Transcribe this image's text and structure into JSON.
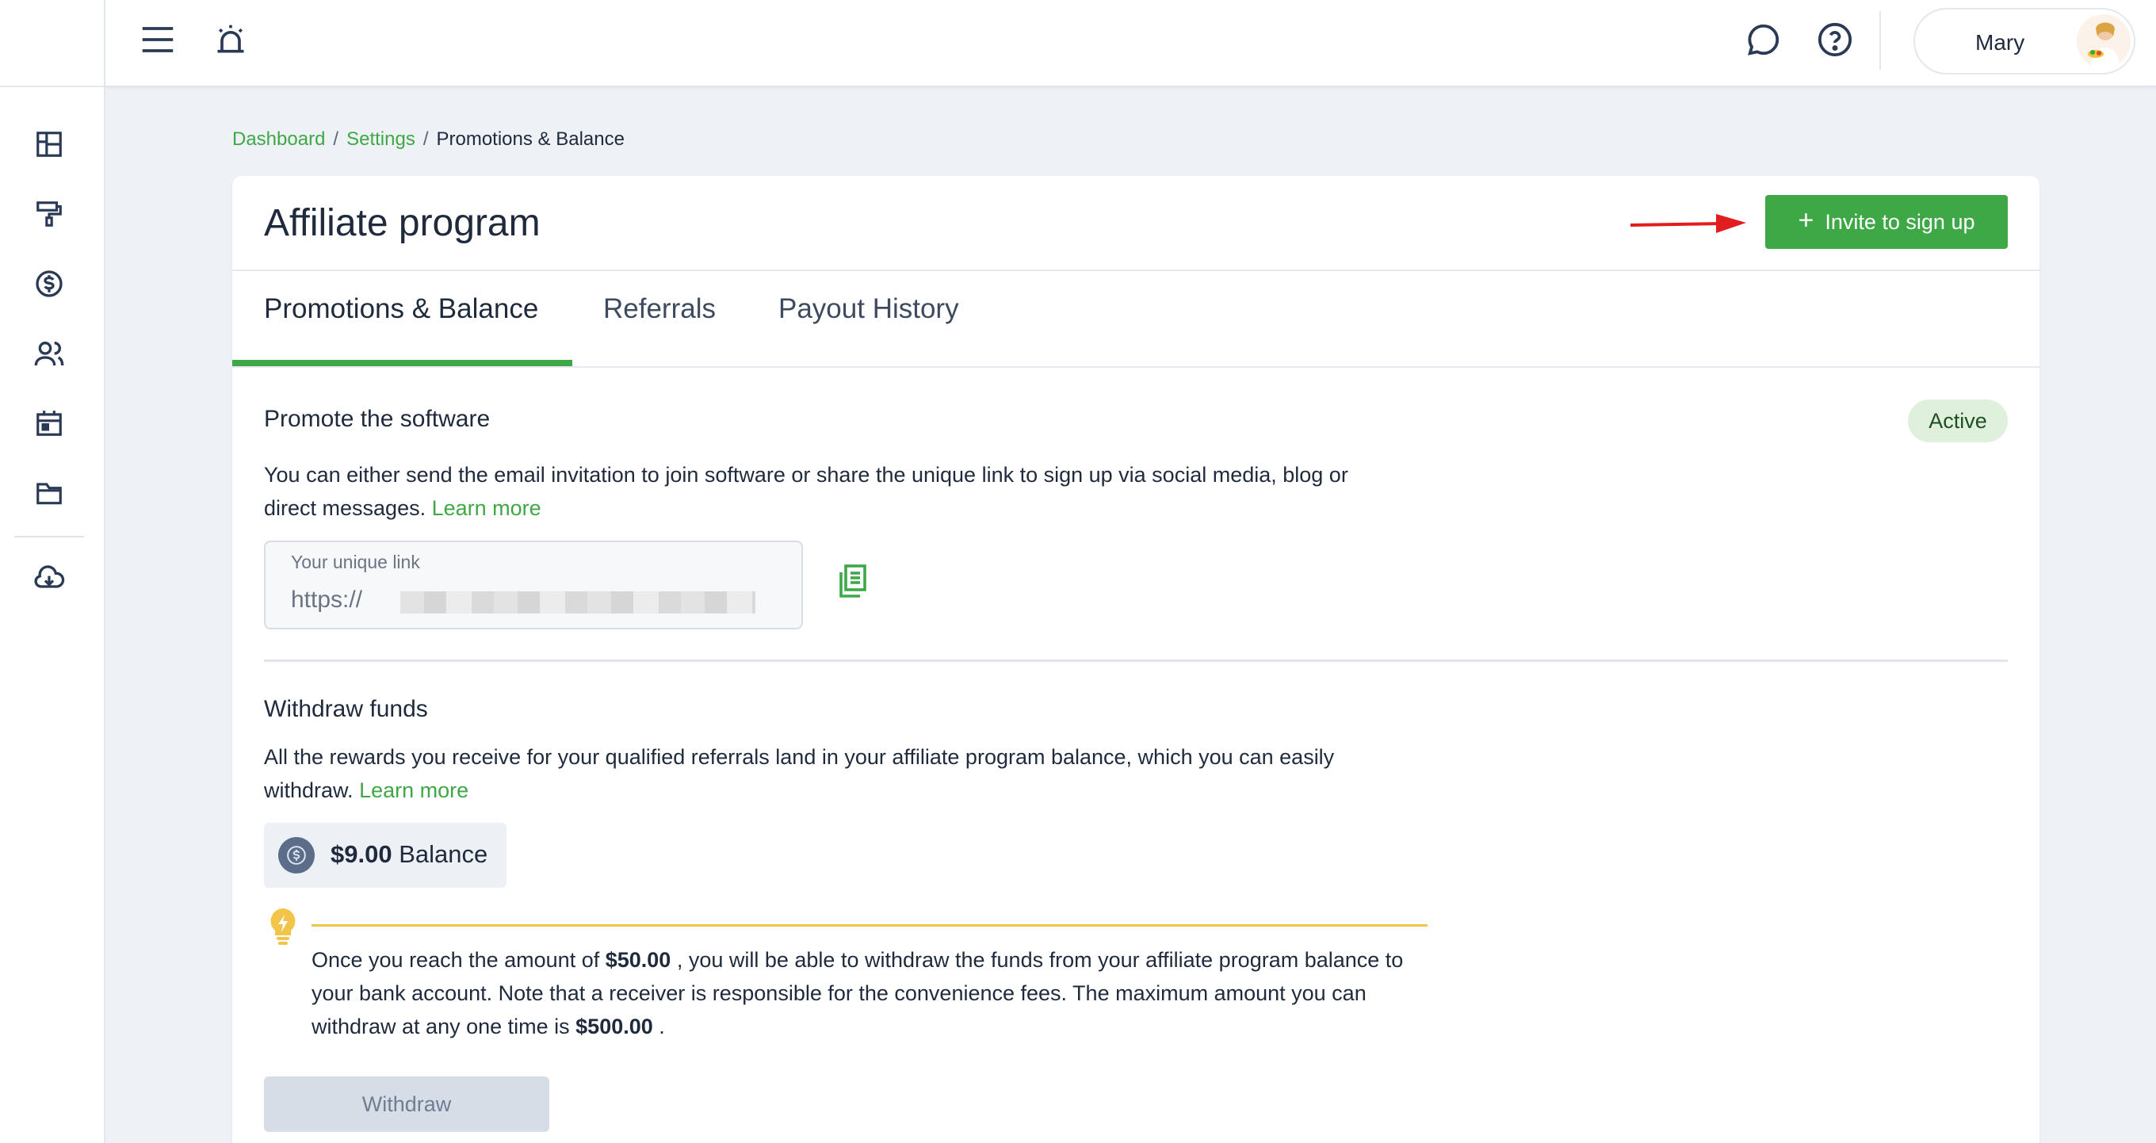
{
  "topbar": {
    "user_name": "Mary"
  },
  "breadcrumb": {
    "items": [
      "Dashboard",
      "Settings"
    ],
    "current": "Promotions & Balance",
    "separator": "/"
  },
  "page": {
    "title": "Affiliate program",
    "invite_button": "Invite to sign up",
    "invite_icon": "+"
  },
  "tabs": [
    {
      "label": "Promotions & Balance",
      "active": true
    },
    {
      "label": "Referrals",
      "active": false
    },
    {
      "label": "Payout History",
      "active": false
    }
  ],
  "promote": {
    "title": "Promote the software",
    "status": "Active",
    "description": "You can either send the email invitation to join software or share the unique link to sign up via social media, blog or direct messages.",
    "learn_more": "Learn more",
    "link_label": "Your unique link",
    "link_value": "https://"
  },
  "withdraw": {
    "title": "Withdraw funds",
    "description": "All the rewards you receive for your qualified referrals land in your affiliate program balance, which you can easily withdraw.",
    "learn_more": "Learn more",
    "balance_amount": "$9.00",
    "balance_label": "Balance",
    "tip_part1": "Once you reach the amount of ",
    "tip_min": "$50.00",
    "tip_part2": " , you will be able to withdraw the funds from your affiliate program balance to your bank account. Note that a receiver is responsible for the convenience fees. The maximum amount you can withdraw at any one time is ",
    "tip_max": "$500.00",
    "tip_part3": " .",
    "button": "Withdraw"
  },
  "colors": {
    "accent": "#3fa846",
    "status_bg": "#dff1dc",
    "tip": "#f3c44a"
  }
}
